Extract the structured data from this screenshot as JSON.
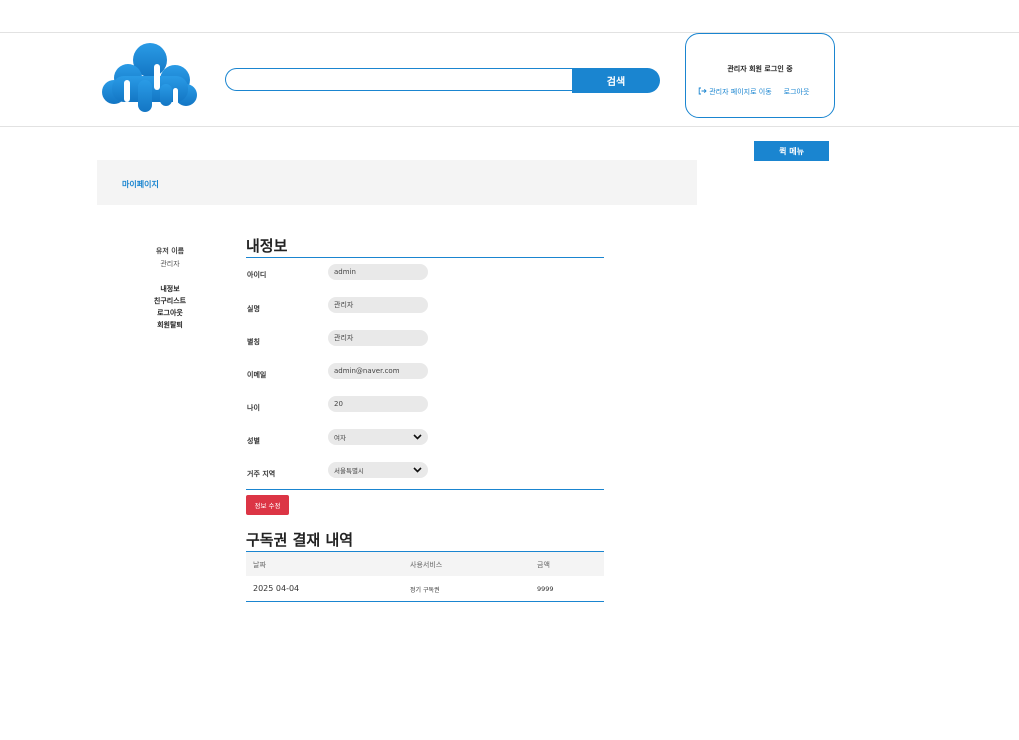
{
  "header": {
    "search": {
      "value": "",
      "placeholder": "",
      "button_label": "검색"
    },
    "login_box": {
      "status": "관리자 회원 로그인 중",
      "admin_link": "관리자 페이지로 이동",
      "logout_link": "로그아웃"
    }
  },
  "quick_menu": {
    "label": "퀵 메뉴"
  },
  "mypage": {
    "title": "마이페이지"
  },
  "sidebar": {
    "user_name_label": "유저 이름",
    "user_role": "관리자",
    "menu": [
      "내정보",
      "친구리스트",
      "로그아웃",
      "회원탈퇴"
    ]
  },
  "profile": {
    "title": "내정보",
    "fields": [
      {
        "label": "아이디",
        "value": "admin"
      },
      {
        "label": "실명",
        "value": "관리자"
      },
      {
        "label": "별칭",
        "value": "관리자"
      },
      {
        "label": "이메일",
        "value": "admin@naver.com"
      },
      {
        "label": "나이",
        "value": "20"
      }
    ],
    "selects": [
      {
        "label": "성별",
        "value": "여자"
      },
      {
        "label": "거주 지역",
        "value": "서울특별시"
      }
    ],
    "edit_button": "정보 수정"
  },
  "subscription": {
    "title": "구독권 결재 내역",
    "columns": [
      "날짜",
      "사용서비스",
      "금액"
    ],
    "rows": [
      {
        "date": "2025 04-04",
        "service": "정기 구독권",
        "amount": "9999"
      }
    ]
  },
  "colors": {
    "accent": "#1a85d0",
    "danger": "#dc3545",
    "panel": "#f4f4f4",
    "field": "#e9e9e9"
  }
}
